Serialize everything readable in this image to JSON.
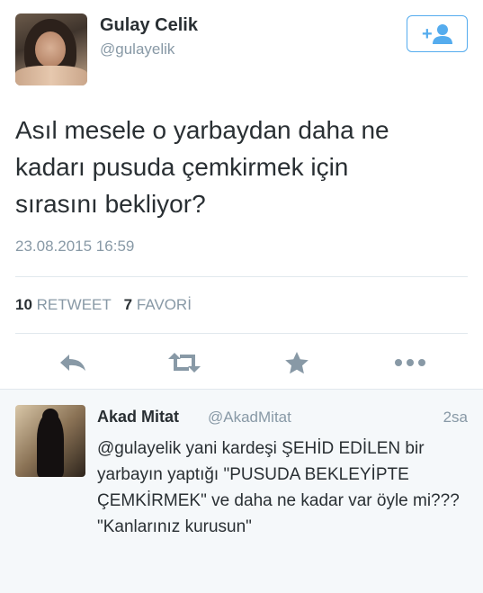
{
  "tweet": {
    "author_name": "Gulay Celik",
    "author_handle": "@gulayelik",
    "text": "Asıl mesele o yarbaydan daha ne\nkadarı pusuda çemkirmek için\nsırasını  bekliyor?",
    "timestamp": "23.08.2015 16:59",
    "retweet_count": "10",
    "retweet_label": "RETWEET",
    "favorite_count": "7",
    "favorite_label": "FAVORİ"
  },
  "actions": [
    {
      "icon": "reply-icon"
    },
    {
      "icon": "retweet-icon"
    },
    {
      "icon": "star-icon"
    },
    {
      "icon": "more-icon"
    }
  ],
  "reply": {
    "author_name": "Akad Mitat",
    "author_handle": "@AkadMitat",
    "time": "2sa",
    "text": "@gulayelik yani kardeşi ŞEHİD EDİLEN bir yarbayın yaptığı \"PUSUDA BEKLEYİPTE ÇEMKİRMEK\" ve daha ne kadar var öyle mi??? \"Kanlarınız kurusun\""
  },
  "colors": {
    "accent": "#55acee",
    "icon_gray": "#8899a6",
    "text": "#292f33"
  }
}
